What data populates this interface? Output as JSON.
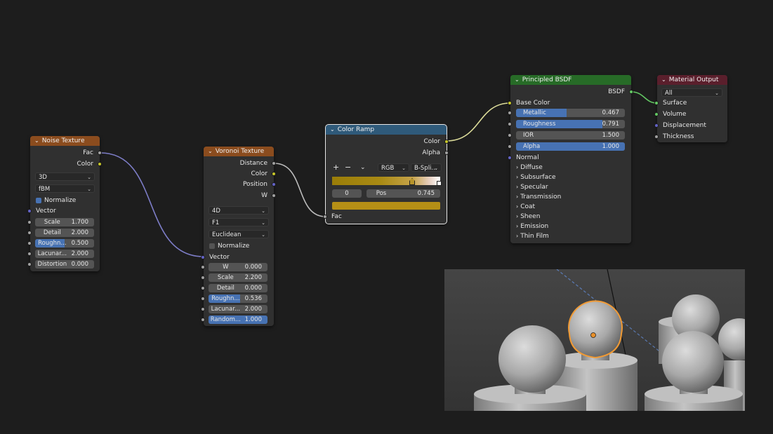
{
  "colors": {
    "noise_header": "#8b4c1e",
    "voronoi_header": "#8b4c1e",
    "colorramp_header": "#2f5a7a",
    "bsdf_header": "#276b27",
    "output_header": "#5a1f2c",
    "accent_blue": "#4772b3",
    "socket_gray": "#a1a1a1",
    "socket_yellow": "#c7c729",
    "socket_purple": "#6363c7",
    "socket_green": "#63c763"
  },
  "noise": {
    "title": "Noise Texture",
    "out_fac": "Fac",
    "out_color": "Color",
    "dim": "3D",
    "type": "fBM",
    "normalize": "Normalize",
    "vector": "Vector",
    "fields": [
      {
        "label": "Scale",
        "value": "1.700"
      },
      {
        "label": "Detail",
        "value": "2.000"
      },
      {
        "label": "Roughn...",
        "value": "0.500",
        "fill": 0.5
      },
      {
        "label": "Lacunar...",
        "value": "2.000"
      },
      {
        "label": "Distortion",
        "value": "0.000"
      }
    ]
  },
  "voronoi": {
    "title": "Voronoi Texture",
    "out_distance": "Distance",
    "out_color": "Color",
    "out_position": "Position",
    "out_w": "W",
    "dim": "4D",
    "feature": "F1",
    "metric": "Euclidean",
    "normalize": "Normalize",
    "vector": "Vector",
    "fields": [
      {
        "label": "W",
        "value": "0.000"
      },
      {
        "label": "Scale",
        "value": "2.200"
      },
      {
        "label": "Detail",
        "value": "0.000"
      },
      {
        "label": "Roughn...",
        "value": "0.536",
        "fill": 0.536
      },
      {
        "label": "Lacunar...",
        "value": "2.000"
      },
      {
        "label": "Random...",
        "value": "1.000",
        "fill": 1.0
      }
    ]
  },
  "ramp": {
    "title": "Color Ramp",
    "out_color": "Color",
    "out_alpha": "Alpha",
    "add": "+",
    "remove": "−",
    "mode": "RGB",
    "interp": "B-Spli...",
    "index": "0",
    "pos_label": "Pos",
    "pos_value": "0.745",
    "in_fac": "Fac"
  },
  "bsdf": {
    "title": "Principled BSDF",
    "out_bsdf": "BSDF",
    "base_color": "Base Color",
    "fields": [
      {
        "label": "Metallic",
        "value": "0.467",
        "fill": 0.467
      },
      {
        "label": "Roughness",
        "value": "0.791",
        "fill": 0.791
      },
      {
        "label": "IOR",
        "value": "1.500"
      },
      {
        "label": "Alpha",
        "value": "1.000",
        "fill": 1.0
      }
    ],
    "normal": "Normal",
    "panels": [
      "Diffuse",
      "Subsurface",
      "Specular",
      "Transmission",
      "Coat",
      "Sheen",
      "Emission",
      "Thin Film"
    ]
  },
  "output": {
    "title": "Material Output",
    "target": "All",
    "inputs": [
      "Surface",
      "Volume",
      "Displacement",
      "Thickness"
    ]
  }
}
